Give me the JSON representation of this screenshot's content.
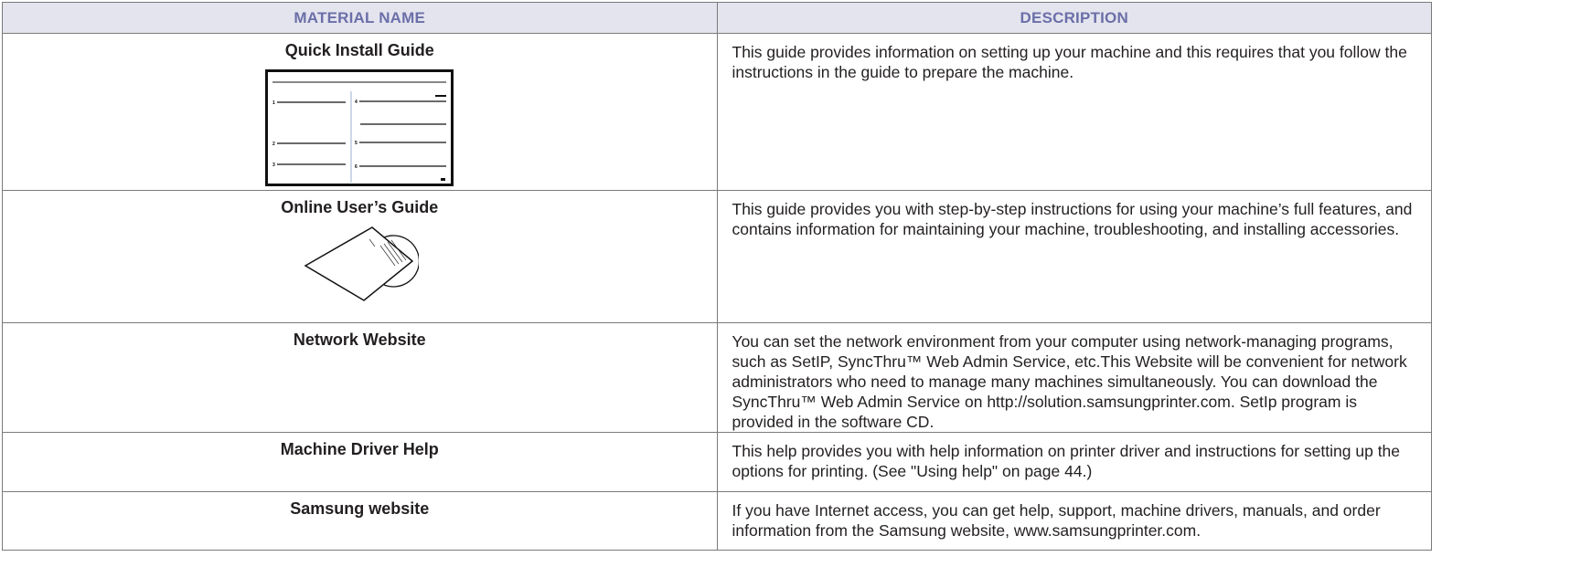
{
  "table": {
    "headers": {
      "name": "MATERIAL NAME",
      "description": "DESCRIPTION"
    },
    "rows": [
      {
        "name": "Quick Install Guide",
        "description": "This guide provides information on setting up your machine and this requires that you follow the instructions in the guide to prepare the machine.",
        "image_icon": "quick-install-guide-illustration"
      },
      {
        "name": "Online User’s Guide",
        "description": "This guide provides you with step-by-step instructions for using your machine’s full features, and contains information for maintaining your machine, troubleshooting, and installing accessories.",
        "image_icon": "cd-sleeve-illustration"
      },
      {
        "name": "Network Website",
        "description": "You can set the network environment from your computer using network-managing programs, such as SetIP, SyncThru™ Web Admin Service, etc.This Website will be convenient for network administrators who need to manage many machines simultaneously. You can download the SyncThru™ Web Admin Service on http://solution.samsungprinter.com. SetIp program is provided in the software CD."
      },
      {
        "name": "Machine Driver Help",
        "description": "This help provides you with help information on printer driver and instructions for setting up the options for printing. (See \"Using help\" on page 44.)"
      },
      {
        "name": "Samsung website",
        "description": "If you have Internet access, you can get help, support, machine drivers, manuals, and order information from the Samsung website, www.samsungprinter.com."
      }
    ]
  },
  "colors": {
    "header_bg": "#e4e4ee",
    "header_text": "#6b6fa8",
    "border": "#7a7a7a"
  }
}
